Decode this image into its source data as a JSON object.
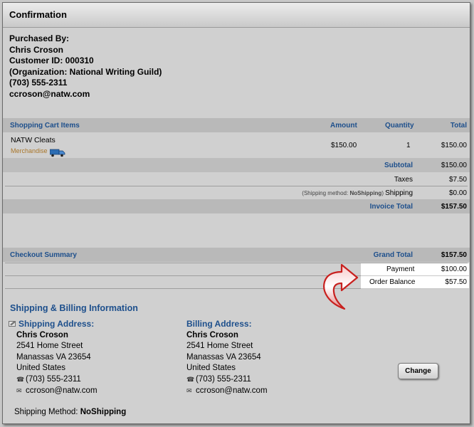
{
  "header": {
    "title": "Confirmation"
  },
  "purchaser": {
    "label": "Purchased By:",
    "name": "Chris Croson",
    "customer_id": "Customer ID: 000310",
    "organization": "(Organization: National Writing Guild)",
    "phone": "(703) 555-2311",
    "email": "ccroson@natw.com"
  },
  "cart": {
    "header": {
      "items": "Shopping Cart Items",
      "amount": "Amount",
      "quantity": "Quantity",
      "total": "Total"
    },
    "items": [
      {
        "name": "NATW Cleats",
        "category": "Merchandise",
        "amount": "$150.00",
        "quantity": "1",
        "total": "$150.00"
      }
    ],
    "subtotal_label": "Subtotal",
    "subtotal_value": "$150.00",
    "taxes_label": "Taxes",
    "taxes_value": "$7.50",
    "shipping_note_prefix": "(Shipping method: ",
    "shipping_note_method": "NoShipping",
    "shipping_note_suffix": ")",
    "shipping_label": "Shipping",
    "shipping_value": "$0.00",
    "invoice_total_label": "Invoice Total",
    "invoice_total_value": "$157.50"
  },
  "checkout": {
    "summary_label": "Checkout Summary",
    "grand_total_label": "Grand Total",
    "grand_total_value": "$157.50",
    "payment_label": "Payment",
    "payment_value": "$100.00",
    "balance_label": "Order Balance",
    "balance_value": "$57.50"
  },
  "shipping_billing": {
    "title": "Shipping & Billing Information",
    "shipping": {
      "head": "Shipping Address:",
      "name": "Chris Croson",
      "street": "2541 Home Street",
      "city": "Manassas VA 23654",
      "country": "United States",
      "phone": "(703) 555-2311",
      "email": "ccroson@natw.com"
    },
    "billing": {
      "head": "Billing Address:",
      "name": "Chris Croson",
      "street": "2541 Home Street",
      "city": "Manassas VA 23654",
      "country": "United States",
      "phone": "(703) 555-2311",
      "email": "ccroson@natw.com"
    },
    "change_label": "Change",
    "ship_method_label": "Shipping Method:",
    "ship_method_value": "NoShipping"
  },
  "colors": {
    "accent_blue": "#1d4f8c",
    "merch_orange": "#a9762a",
    "arrow_red": "#c8201e"
  },
  "icons": {
    "truck": "truck-icon",
    "edit": "edit-icon",
    "phone": "phone-icon",
    "email": "envelope-icon",
    "arrow": "curved-arrow-icon"
  }
}
